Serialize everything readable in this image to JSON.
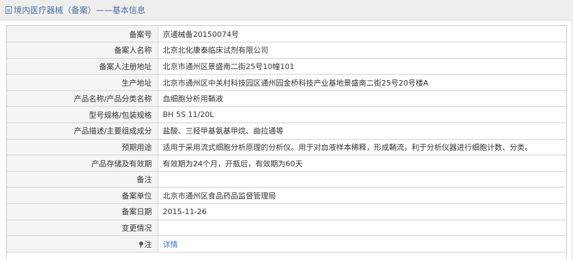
{
  "header": {
    "icon": "document-icon",
    "title": "境内医疗器械（备案）——基本信息"
  },
  "rows": [
    {
      "label": "备案号",
      "value": "京通械备20150074号"
    },
    {
      "label": "备案人名称",
      "value": "北京北化康泰临床试剂有限公司"
    },
    {
      "label": "备案人注册地址",
      "value": "北京市通州区景盛南二街25号10幢101"
    },
    {
      "label": "生产地址",
      "value": "北京市通州区中关村科技园区通州园金桥科技产业基地景盛南二街25号20号楼A"
    },
    {
      "label": "产品名称/产品分类名称",
      "value": "血细胞分析用鞘液"
    },
    {
      "label": "型号规格/包装规格",
      "value": "BH 5S 11/20L"
    },
    {
      "label": "产品描述/主要组成成分",
      "value": "盐酸、三羟甲基氨基甲烷、曲拉通等"
    },
    {
      "label": "预期用途",
      "value": "适用于采用流式细胞分析原理的分析仪。用于对血液样本稀释，形成鞘流，利于分析仪器进行细胞计数、分类。"
    },
    {
      "label": "产品存储及有效期",
      "value": "有效期为24个月，开瓶后，有效期为60天"
    },
    {
      "label": "备注",
      "value": ""
    },
    {
      "label": "备案单位",
      "value": "北京市通州区食品药品监督管理局"
    },
    {
      "label": "备案日期",
      "value": "2015-11-26"
    },
    {
      "label": "变更情况",
      "value": ""
    }
  ],
  "note_row": {
    "icon": "pin-icon",
    "label": "注",
    "link_text": "详情"
  }
}
